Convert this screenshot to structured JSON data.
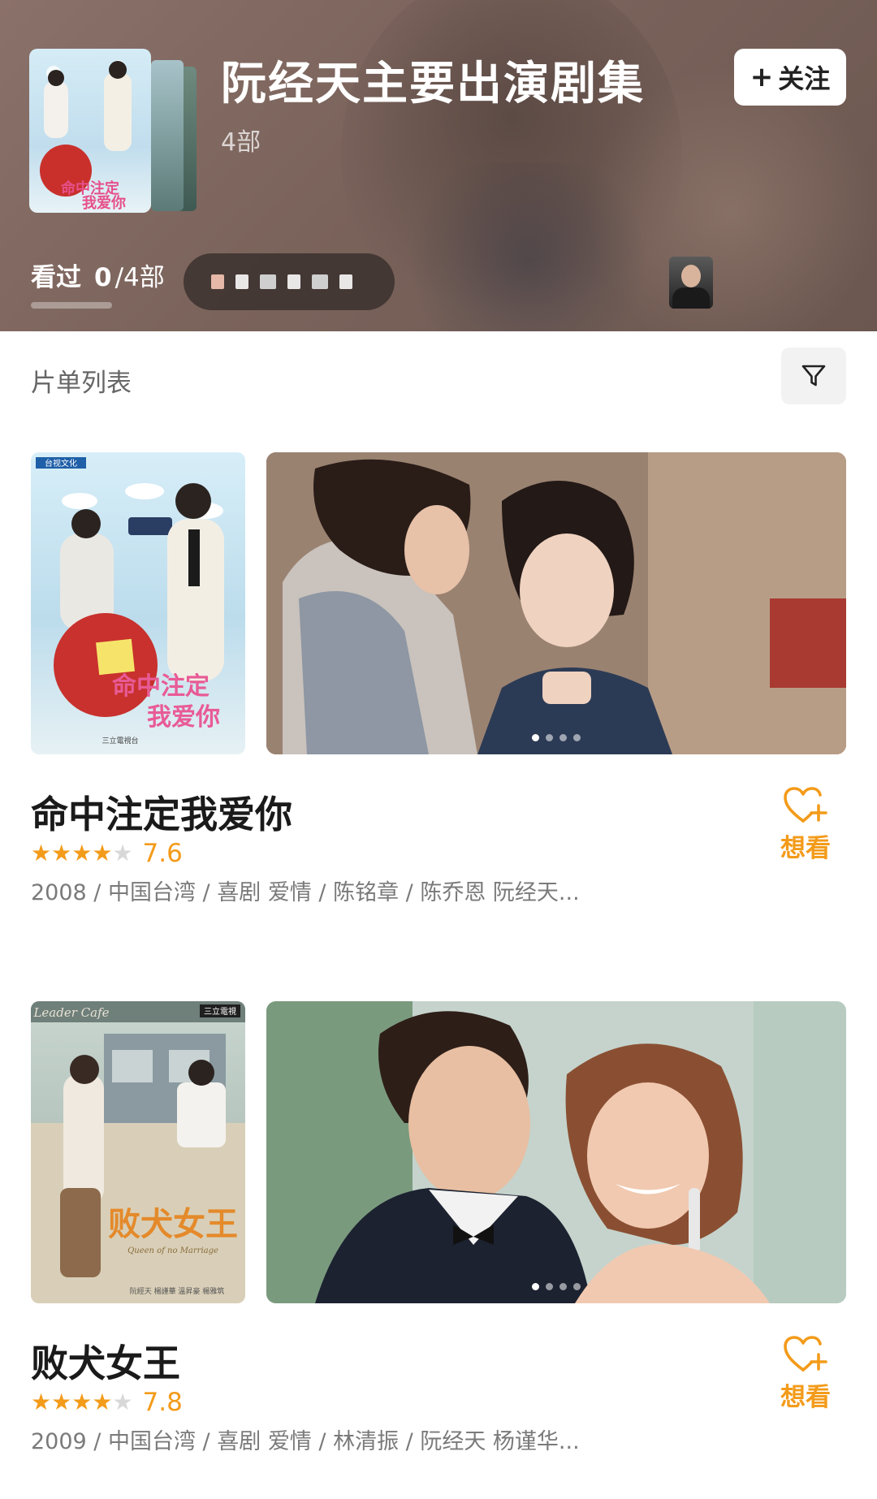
{
  "header": {
    "title": "阮经天主要出演剧集",
    "count": "4部",
    "follow_label": "关注",
    "follow_icon": "plus-icon",
    "watched_label": "看过",
    "watched_num": "0",
    "watched_total": "/4部",
    "watched_progress": 0
  },
  "list": {
    "title": "片单列表",
    "filter_icon": "filter-icon"
  },
  "items": [
    {
      "title": "命中注定我爱你",
      "stars": 4,
      "score": "7.6",
      "meta": "2008 / 中国台湾 / 喜剧 爱情 / 陈铭章 / 陈乔恩 阮经天...",
      "want_label": "想看",
      "slide_count": 4,
      "active_slide": 0,
      "poster_text": "命中注定我爱你",
      "poster_badge": "台视文化"
    },
    {
      "title": "败犬女王",
      "stars": 4,
      "score": "7.8",
      "meta": "2009 / 中国台湾 / 喜剧 爱情 / 林清振 / 阮经天 杨谨华...",
      "want_label": "想看",
      "slide_count": 4,
      "active_slide": 0,
      "poster_text": "败犬女王",
      "poster_sub": "Queen of no Marriage",
      "poster_badge": "三立電視"
    }
  ],
  "colors": {
    "accent": "#f39b1a",
    "header_bg": "#7a635b",
    "star_empty": "#d8d8d8"
  }
}
